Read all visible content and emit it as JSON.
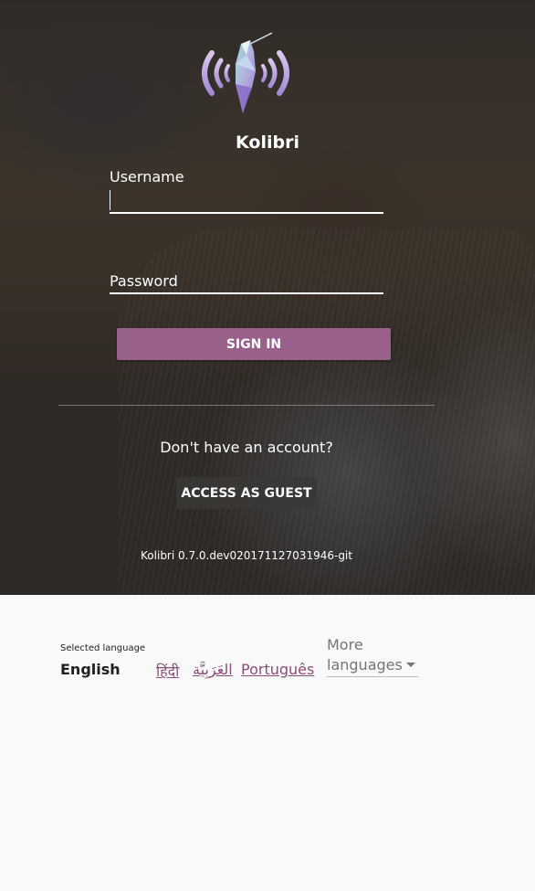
{
  "app": {
    "name": "Kolibri",
    "version": "Kolibri 0.7.0.dev020171127031946-git",
    "logo_icon": "hummingbird-icon"
  },
  "signin": {
    "username_label": "Username",
    "username_value": "",
    "password_label": "Password",
    "password_value": "",
    "submit_label": "SIGN IN",
    "no_account_text": "Don't have an account?",
    "guest_label": "ACCESS AS GUEST"
  },
  "language": {
    "caption": "Selected language",
    "current": "English",
    "options": [
      "हिंदी",
      "العَرَبِيَّة",
      "Português"
    ],
    "more_label": "More languages"
  },
  "colors": {
    "primary": "#996189",
    "link": "#8a4d79",
    "footer_background": "#f9f9f9"
  }
}
